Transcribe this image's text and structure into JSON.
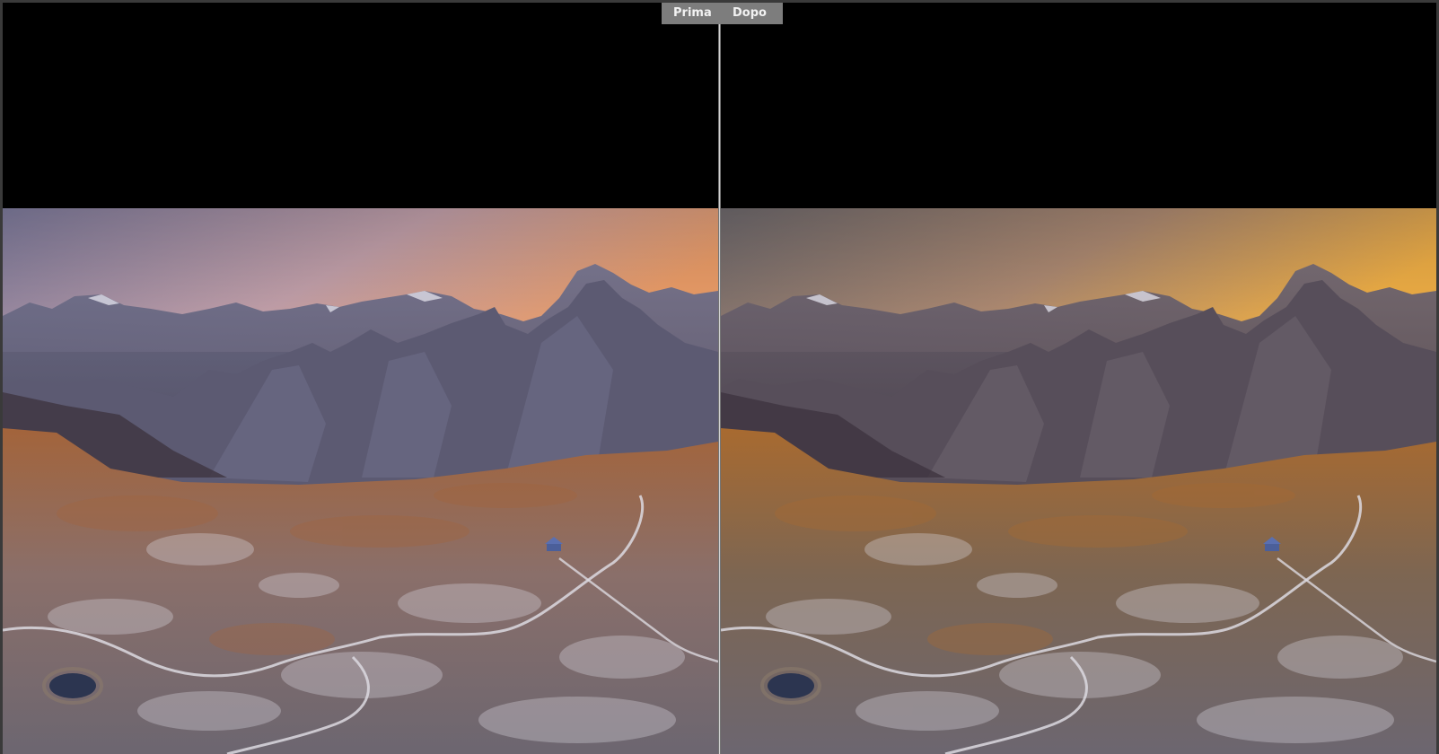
{
  "compare": {
    "before_label": "Prima",
    "after_label": "Dopo"
  },
  "panels": [
    {
      "id": "before",
      "sky_top": "#7f7c9e",
      "sky_mid": "#c6a3ad",
      "sky_horizon": "#f0a06a",
      "peak_color": "#6f6f8a",
      "ridge_color": "#5c5a72",
      "ground_color": "#8a6f6a",
      "earth_color": "#a3643b"
    },
    {
      "id": "after",
      "sky_top": "#6f6a6e",
      "sky_mid": "#b08c74",
      "sky_horizon": "#f4b247",
      "peak_color": "#6d6470",
      "ridge_color": "#574e5a",
      "ground_color": "#7d6652",
      "earth_color": "#a86a30"
    }
  ]
}
